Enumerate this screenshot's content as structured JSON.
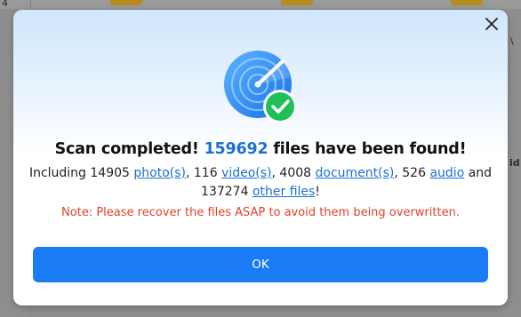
{
  "background": {
    "left_glyph": "4",
    "right_glyph_1": "\\",
    "right_glyph_2": "id"
  },
  "dialog": {
    "close_icon": "close-icon",
    "hero_icon": "scan-complete-icon",
    "title_prefix": "Scan completed! ",
    "title_count": "159692",
    "title_suffix": " files have been found!",
    "detail": {
      "intro": "Including 14905 ",
      "photos_link": "photo(s)",
      "sep1": ", 116 ",
      "videos_link": "video(s)",
      "sep2": ", 4008 ",
      "documents_link": "document(s)",
      "sep3": ", 526 ",
      "audio_link": "audio",
      "sep4": " and",
      "line2_prefix": "137274 ",
      "other_link": "other files",
      "line2_suffix": "!"
    },
    "note": "Note: Please recover the files ASAP to avoid them being overwritten.",
    "ok_label": "OK"
  },
  "colors": {
    "accent": "#1a7cf5",
    "count": "#1a73d9",
    "note": "#e0412b",
    "check": "#1fbf5a"
  }
}
